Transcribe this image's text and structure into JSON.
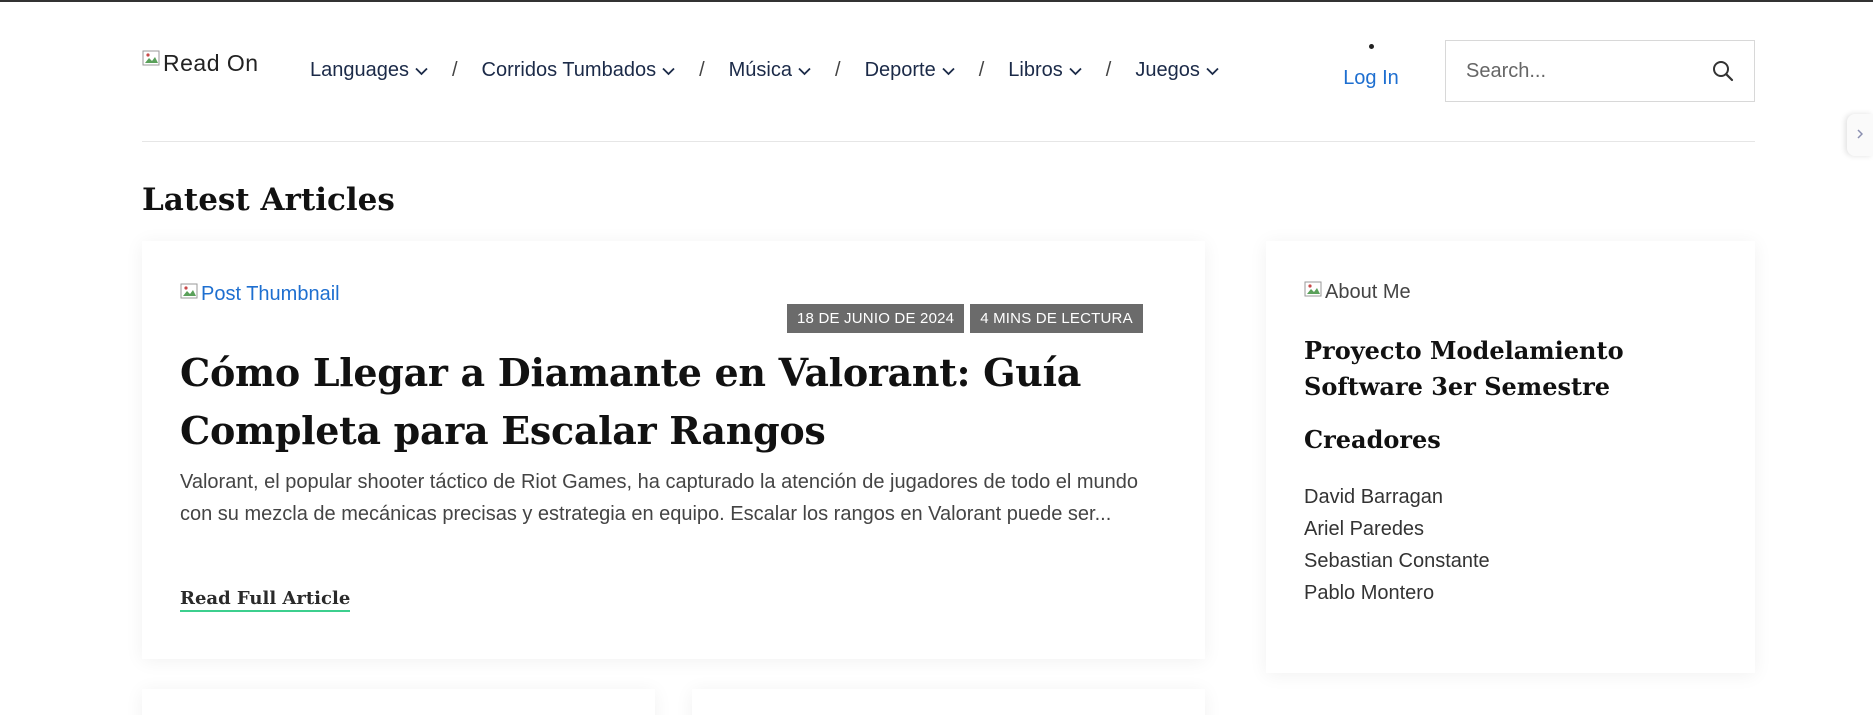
{
  "header": {
    "logo_alt": "Read On",
    "nav": [
      {
        "label": "Languages"
      },
      {
        "label": "Corridos Tumbados"
      },
      {
        "label": "Música"
      },
      {
        "label": "Deporte"
      },
      {
        "label": "Libros"
      },
      {
        "label": "Juegos"
      }
    ],
    "nav_separator": "/",
    "login_label": "Log In",
    "search_placeholder": "Search..."
  },
  "main": {
    "section_title": "Latest Articles",
    "article": {
      "thumbnail_alt": "Post Thumbnail",
      "date": "18 DE JUNIO DE 2024",
      "read_time": "4 MINS DE LECTURA",
      "title": "Cómo Llegar a Diamante en Valorant: Guía Completa para Escalar Rangos",
      "excerpt": "Valorant, el popular shooter táctico de Riot Games, ha capturado la atención de jugadores de todo el mundo con su mezcla de mecánicas precisas y estrategia en equipo. Escalar los rangos en Valorant puede ser...",
      "read_more": "Read Full Article"
    }
  },
  "sidebar": {
    "about_alt": "About Me",
    "title": "Proyecto Modelamiento Software 3er Semestre",
    "creators_heading": "Creadores",
    "creators": [
      "David Barragan",
      "Ariel Paredes",
      "Sebastian Constante",
      "Pablo Montero"
    ]
  },
  "colors": {
    "accent_link": "#1e6fd0",
    "nav_text": "#1b2a48",
    "badge_bg": "#6b6b6b",
    "underline": "#3ccf8e"
  }
}
